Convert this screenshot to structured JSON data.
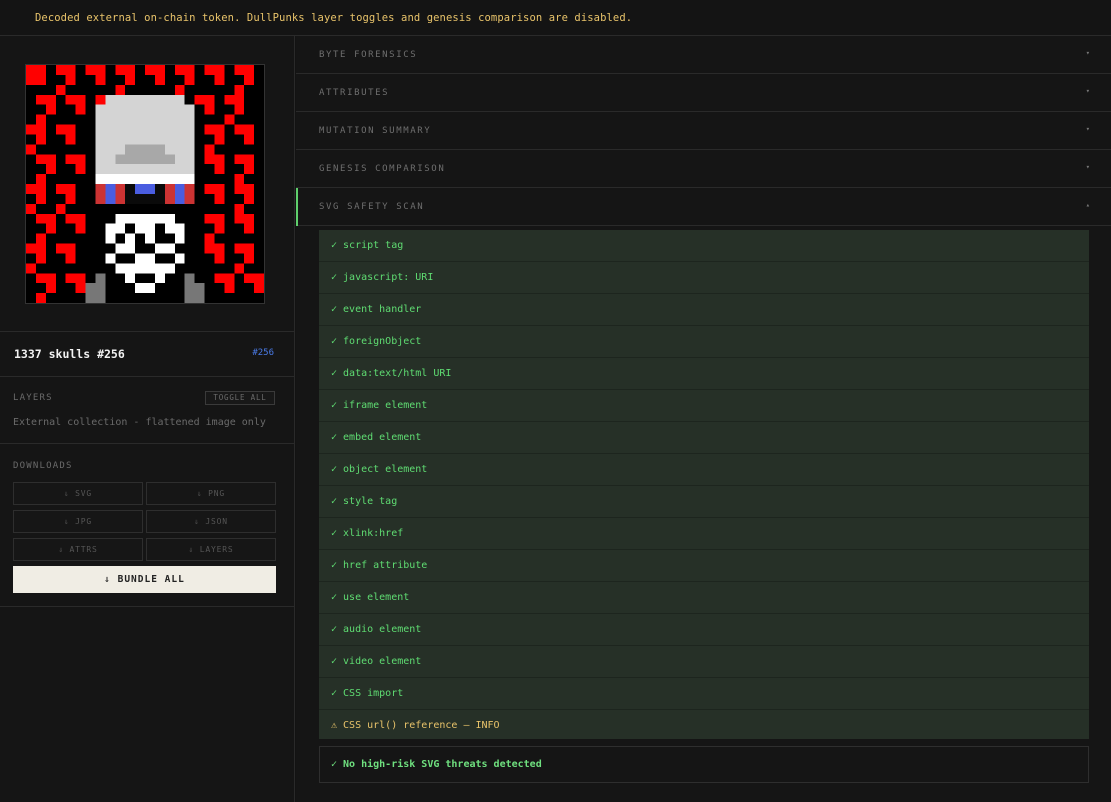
{
  "banner": {
    "message": "Decoded external on-chain token. DullPunks layer toggles and genesis comparison are disabled."
  },
  "token": {
    "name": "1337 skulls #256",
    "id_badge": "#256"
  },
  "layers": {
    "label": "LAYERS",
    "toggle_all": "TOGGLE ALL",
    "note": "External collection - flattened image only"
  },
  "downloads": {
    "label": "DOWNLOADS",
    "buttons": [
      "⇓ SVG",
      "⇓ PNG",
      "⇓ JPG",
      "⇓ JSON",
      "⇓ ATTRS",
      "⇓ LAYERS"
    ],
    "bundle": "⇓ BUNDLE ALL"
  },
  "accordion": [
    {
      "label": "BYTE FORENSICS",
      "chevron": "▾"
    },
    {
      "label": "ATTRIBUTES",
      "chevron": "▾"
    },
    {
      "label": "MUTATION SUMMARY",
      "chevron": "▾"
    },
    {
      "label": "GENESIS COMPARISON",
      "chevron": "▾"
    },
    {
      "label": "SVG SAFETY SCAN",
      "chevron": "▴"
    }
  ],
  "scan_results": [
    "✓ script tag",
    "✓ javascript: URI",
    "✓ event handler",
    "✓ foreignObject",
    "✓ data:text/html URI",
    "✓ iframe element",
    "✓ embed element",
    "✓ object element",
    "✓ style tag",
    "✓ xlink:href",
    "✓ href attribute",
    "✓ use element",
    "✓ audio element",
    "✓ video element",
    "✓ CSS import",
    "⚠ CSS url() reference — INFO"
  ],
  "scan_summary": "✓ No high-risk SVG threats detected",
  "colors": {
    "accent_green": "#5fdc72",
    "warning_amber": "#e8c36a",
    "link_blue": "#4a7be8",
    "art_red": "#ff0000"
  }
}
